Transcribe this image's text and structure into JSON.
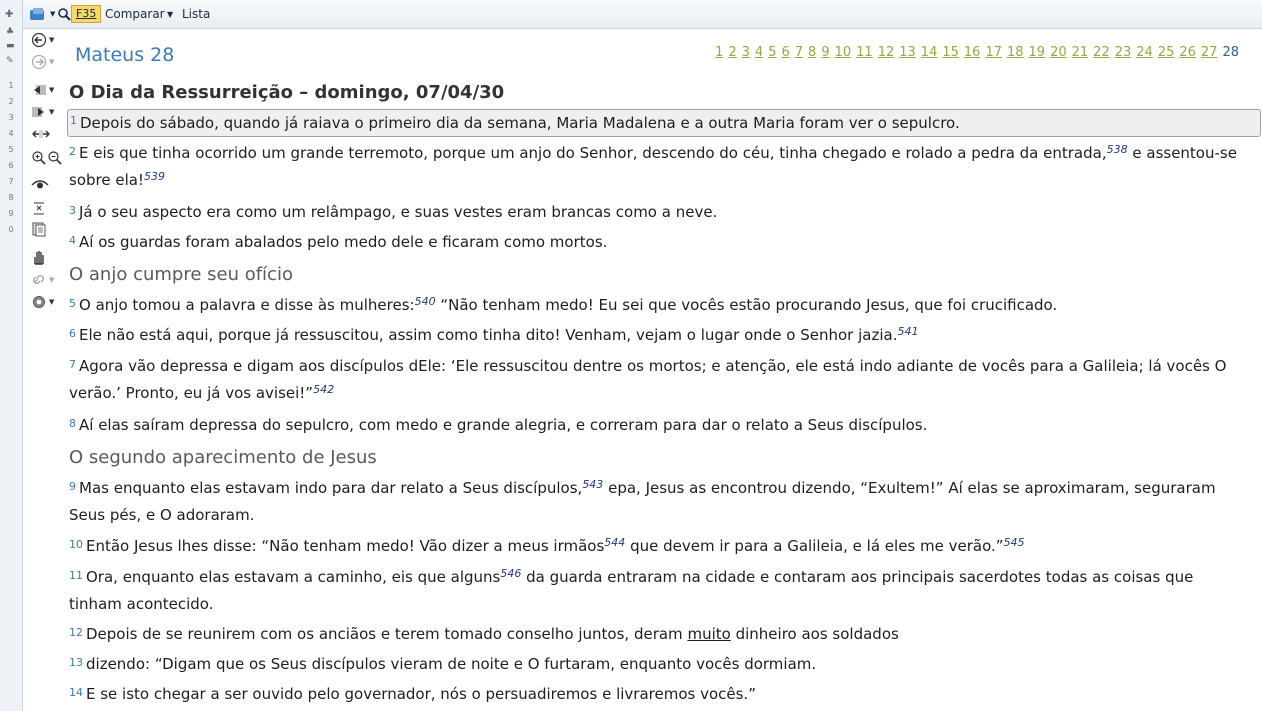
{
  "ruler": {
    "marks": [
      "1",
      "2",
      "3",
      "4",
      "5",
      "6",
      "7",
      "8",
      "9",
      "0"
    ]
  },
  "toolbar": {
    "f35_label": "F35",
    "compare_label": "Comparar",
    "list_label": "Lista"
  },
  "chapter": {
    "title": "Mateus 28",
    "nav": [
      "1",
      "2",
      "3",
      "4",
      "5",
      "6",
      "7",
      "8",
      "9",
      "10",
      "11",
      "12",
      "13",
      "14",
      "15",
      "16",
      "17",
      "18",
      "19",
      "20",
      "21",
      "22",
      "23",
      "24",
      "25",
      "26",
      "27"
    ],
    "current": "28"
  },
  "headings": {
    "main": "O Dia da Ressurreição – domingo, 07/04/30",
    "sec1": "O anjo cumpre seu ofício",
    "sec2": "O segundo aparecimento de Jesus"
  },
  "verses": [
    {
      "n": "1",
      "parts": [
        "Depois do sábado, quando já raiava o primeiro dia da semana, Maria Madalena e a outra Maria foram ver o sepulcro."
      ]
    },
    {
      "n": "2",
      "parts": [
        "E eis que tinha ocorrido um grande terremoto, porque um anjo do Senhor, descendo do céu, tinha chegado e rolado a pedra da entrada,",
        "e assentou-se sobre ela!"
      ],
      "fn": [
        "538",
        "539"
      ]
    },
    {
      "n": "3",
      "parts": [
        "Já o seu aspecto era como um relâmpago, e suas vestes eram brancas como a neve."
      ]
    },
    {
      "n": "4",
      "parts": [
        "Aí os guardas foram abalados pelo medo dele e ficaram como mortos."
      ]
    },
    {
      "n": "5",
      "parts": [
        "O anjo tomou a palavra e disse às mulheres:",
        "“Não tenham medo! Eu sei que vocês estão procurando Jesus, que foi crucificado."
      ],
      "fn": [
        "540"
      ]
    },
    {
      "n": "6",
      "parts": [
        "Ele não está aqui, porque já ressuscitou, assim como tinha dito! Venham, vejam o lugar onde o Senhor jazia."
      ],
      "fn": [
        "541"
      ]
    },
    {
      "n": "7",
      "parts": [
        "Agora vão depressa e digam aos discípulos dEle: ‘Ele ressuscitou dentre os mortos; e atenção, ele está indo adiante de vocês para a Galileia; lá vocês O verão.’ Pronto, eu já vos avisei!”"
      ],
      "fn": [
        "542"
      ]
    },
    {
      "n": "8",
      "parts": [
        "Aí elas saíram depressa do sepulcro, com medo e grande alegria, e correram para dar o relato a Seus discípulos."
      ]
    },
    {
      "n": "9",
      "parts": [
        "Mas enquanto elas estavam indo para dar relato a Seus discípulos,",
        "epa, Jesus as encontrou dizendo, “Exultem!” Aí elas se aproximaram, seguraram Seus pés, e O adoraram."
      ],
      "fn": [
        "543"
      ]
    },
    {
      "n": "10",
      "parts": [
        "Então Jesus lhes disse: “Não tenham medo! Vão dizer a meus irmãos",
        "que devem ir para a Galileia, e lá eles me verão.”"
      ],
      "fn": [
        "544",
        "545"
      ]
    },
    {
      "n": "11",
      "parts": [
        "Ora, enquanto elas estavam a caminho, eis que alguns",
        "da guarda entraram na cidade e contaram aos principais sacerdotes todas as coisas que tinham acontecido."
      ],
      "fn": [
        "546"
      ]
    },
    {
      "n": "12",
      "parts": [
        "Depois de se reunirem com os anciãos e terem tomado conselho juntos, deram",
        "muito",
        "dinheiro aos soldados"
      ]
    },
    {
      "n": "13",
      "parts": [
        "dizendo: “Digam que os Seus discípulos vieram de noite e O furtaram, enquanto vocês dormiam."
      ]
    },
    {
      "n": "14",
      "parts": [
        "E se isto chegar a ser ouvido pelo governador, nós o persuadiremos e livraremos vocês.”"
      ]
    }
  ],
  "icons": [
    "plus-icon",
    "bible-icon",
    "search-icon",
    "back-icon",
    "forward-icon",
    "prev-icon",
    "next-icon",
    "sync-icon",
    "zoom-in-icon",
    "zoom-out-icon",
    "eye-icon",
    "format-icon",
    "page-icon",
    "hand-icon",
    "link-icon",
    "settings-icon"
  ]
}
